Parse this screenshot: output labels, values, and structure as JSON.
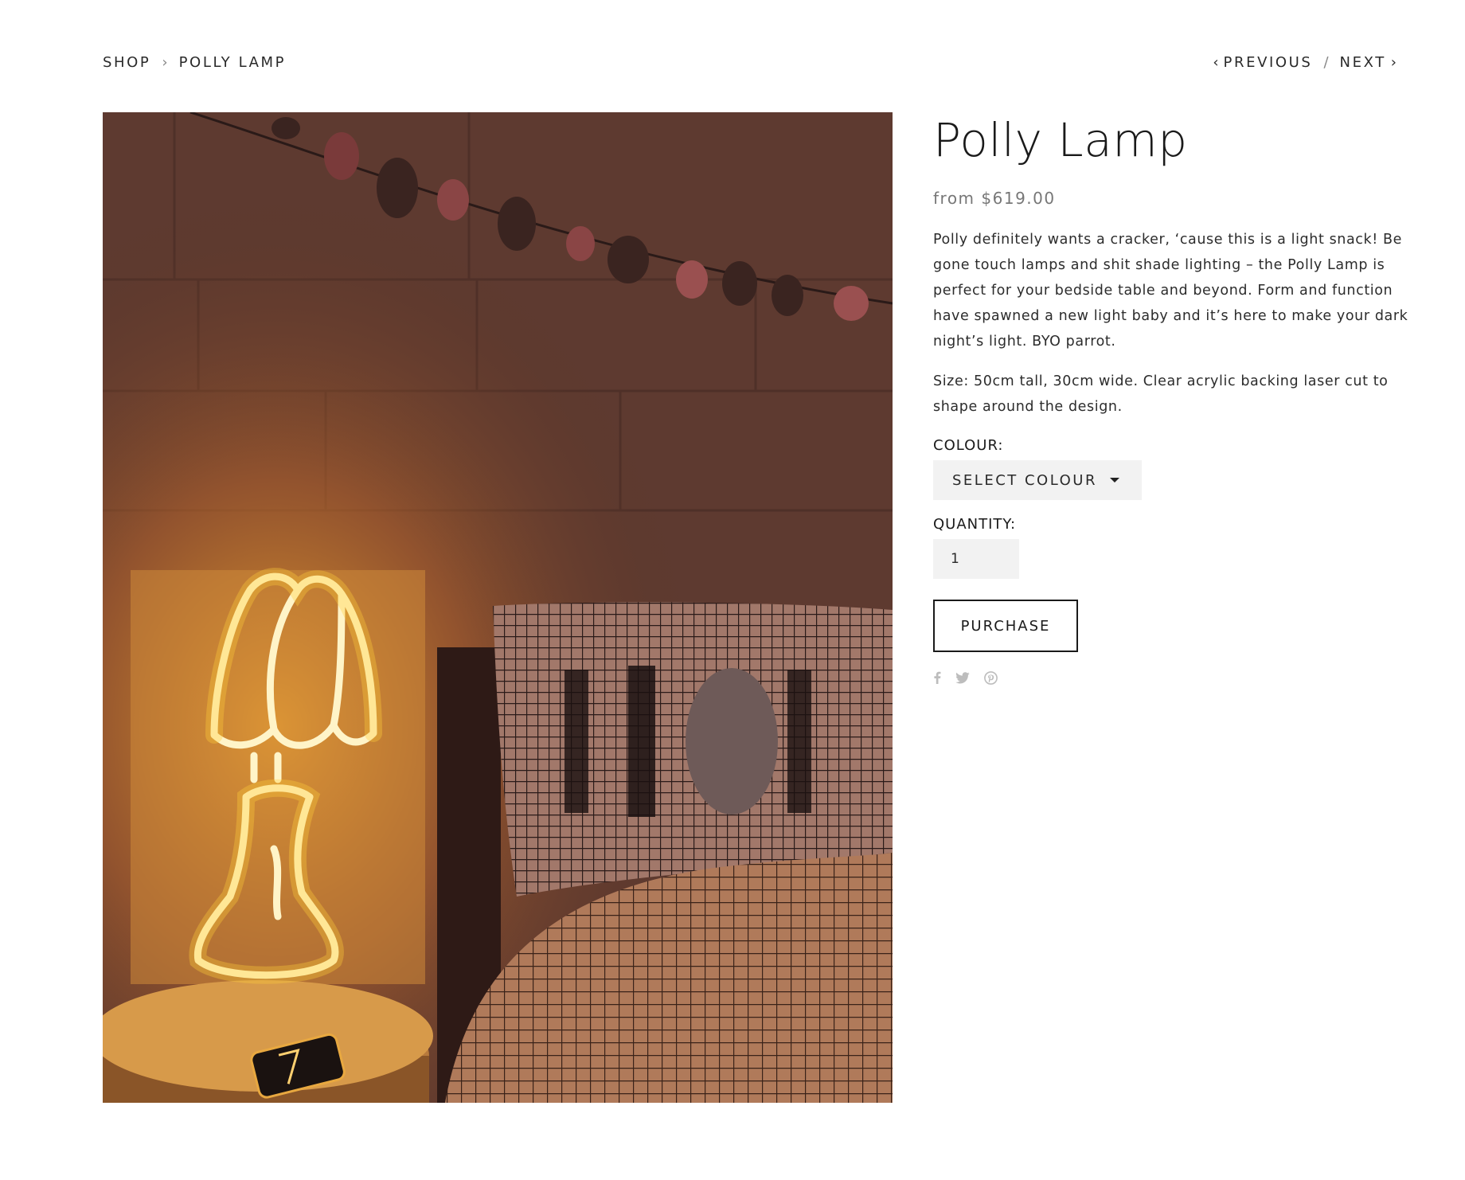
{
  "breadcrumb": {
    "shop": "SHOP",
    "separator": "›",
    "current": "POLLY LAMP"
  },
  "pager": {
    "previous_arrow": "‹",
    "previous": "PREVIOUS",
    "slash": "/",
    "next": "NEXT",
    "next_arrow": "›"
  },
  "product": {
    "title": "Polly Lamp",
    "price": "from $619.00",
    "description": "Polly definitely wants a cracker, ‘cause this is a light snack! Be gone touch lamps and shit shade lighting – the Polly Lamp is perfect for your bedside table and beyond. Form and function have spawned a new light baby and it’s here to make your dark night’s light. BYO parrot.",
    "size_note": "Size: 50cm tall, 30cm wide. Clear acrylic backing laser cut to shape around the design.",
    "image_icon": "neon-lamp-photo"
  },
  "options": {
    "colour_label": "COLOUR:",
    "colour_selected": "SELECT COLOUR",
    "quantity_label": "QUANTITY:",
    "quantity_value": "1"
  },
  "actions": {
    "purchase_label": "PURCHASE"
  },
  "share": {
    "icons": [
      "facebook-icon",
      "twitter-icon",
      "pinterest-icon"
    ]
  },
  "colors": {
    "text": "#222222",
    "muted": "#777777",
    "share_icon": "#bdbdbd",
    "input_bg": "#f2f2f2",
    "neon": "#ffd64a"
  }
}
